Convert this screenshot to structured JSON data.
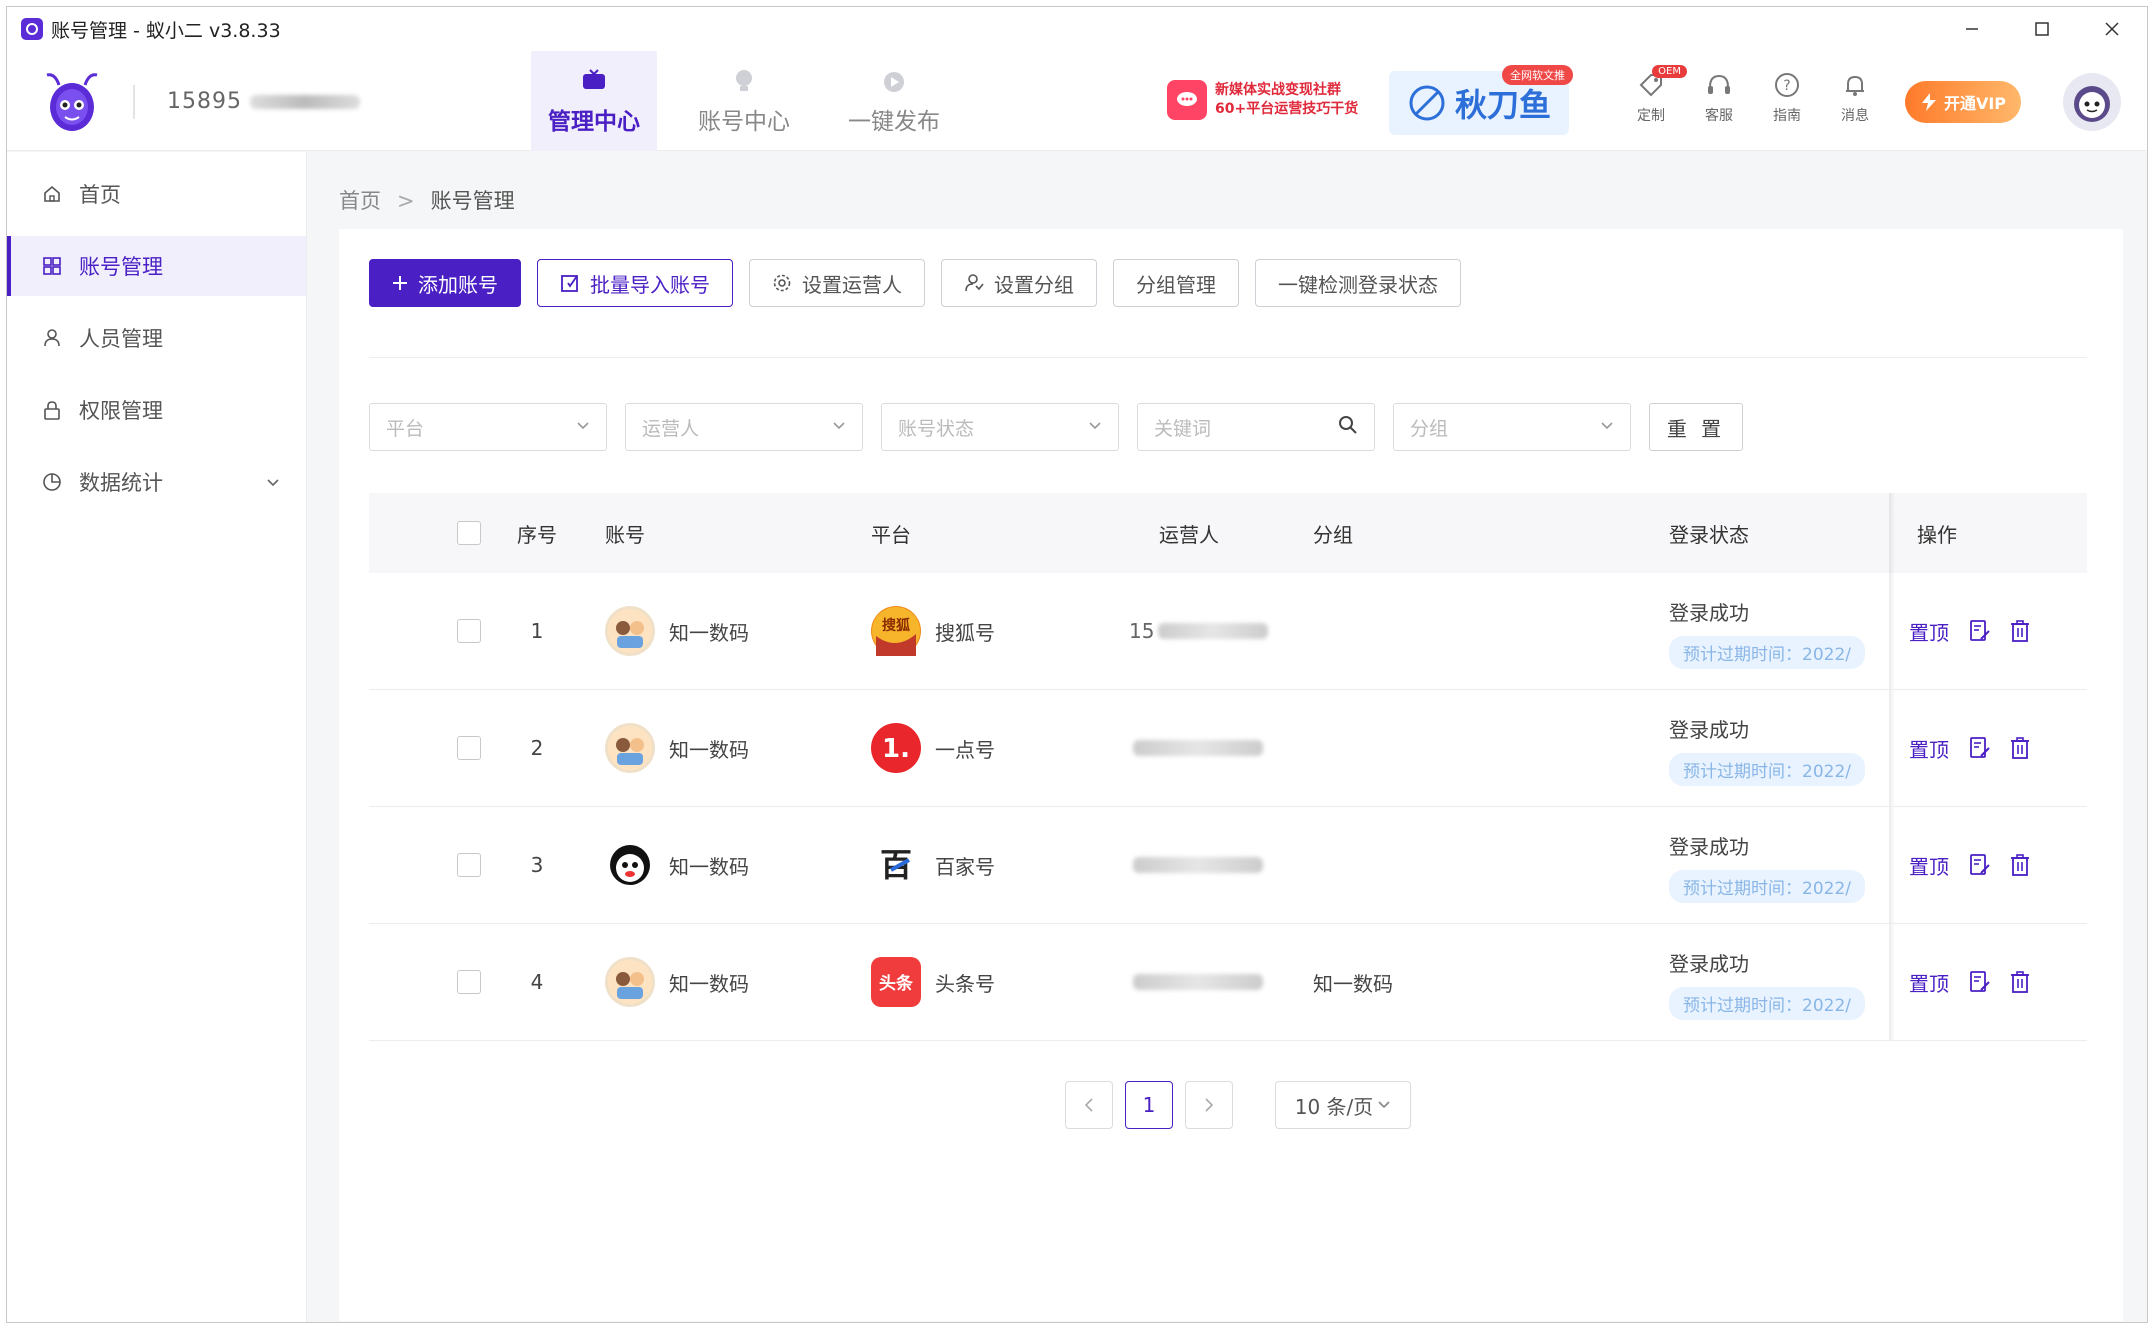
{
  "window": {
    "title": "账号管理 - 蚁小二 v3.8.33"
  },
  "header": {
    "phone_masked": "15895",
    "nav": [
      {
        "label": "管理中心",
        "icon": "tv-icon"
      },
      {
        "label": "账号中心",
        "icon": "bulb-icon"
      },
      {
        "label": "一键发布",
        "icon": "send-icon"
      }
    ],
    "promo1": {
      "line1": "新媒体实战变现社群",
      "line2": "60+平台运营技巧干货"
    },
    "promo2": {
      "brand": "秋刀鱼",
      "tag": "全网软文推"
    },
    "tools": [
      {
        "label": "定制",
        "icon": "tag-icon",
        "badge": "OEM"
      },
      {
        "label": "客服",
        "icon": "headset-icon"
      },
      {
        "label": "指南",
        "icon": "question-icon"
      },
      {
        "label": "消息",
        "icon": "bell-icon"
      }
    ],
    "vip_label": "开通VIP"
  },
  "sidebar": {
    "items": [
      {
        "label": "首页",
        "icon": "home-icon",
        "active": false
      },
      {
        "label": "账号管理",
        "icon": "grid-icon",
        "active": true
      },
      {
        "label": "人员管理",
        "icon": "user-icon",
        "active": false
      },
      {
        "label": "权限管理",
        "icon": "lock-icon",
        "active": false
      },
      {
        "label": "数据统计",
        "icon": "pie-chart-icon",
        "active": false
      }
    ]
  },
  "breadcrumb": {
    "home": "首页",
    "sep": ">",
    "current": "账号管理"
  },
  "toolbar": {
    "add_account": "添加账号",
    "batch_import": "批量导入账号",
    "set_operator": "设置运营人",
    "set_group": "设置分组",
    "group_manage": "分组管理",
    "check_login": "一键检测登录状态"
  },
  "filters": {
    "platform": "平台",
    "operator": "运营人",
    "status": "账号状态",
    "keyword_placeholder": "关键词",
    "group": "分组",
    "reset": "重 置"
  },
  "table": {
    "headers": {
      "no": "序号",
      "account": "账号",
      "platform": "平台",
      "operator": "运营人",
      "group": "分组",
      "status": "登录状态",
      "ops": "操作"
    },
    "rows": [
      {
        "no": "1",
        "account": "知一数码",
        "platform": "搜狐号",
        "platform_color": "#f08a1e",
        "platform_glyph": "搜狐",
        "operator": "15",
        "group": "",
        "status": "登录成功",
        "expire": "预计过期时间：2022/",
        "op_pin": "置顶"
      },
      {
        "no": "2",
        "account": "知一数码",
        "platform": "一点号",
        "platform_color": "#e8262b",
        "platform_glyph": "1.",
        "operator": "",
        "group": "",
        "status": "登录成功",
        "expire": "预计过期时间：2022/",
        "op_pin": "置顶"
      },
      {
        "no": "3",
        "account": "知一数码",
        "platform": "百家号",
        "platform_color": "#ffffff",
        "platform_glyph": "百",
        "operator": "",
        "group": "",
        "status": "登录成功",
        "expire": "预计过期时间：2022/",
        "op_pin": "置顶"
      },
      {
        "no": "4",
        "account": "知一数码",
        "platform": "头条号",
        "platform_color": "#f03c3c",
        "platform_glyph": "头条",
        "operator": "",
        "group": "知一数码",
        "status": "登录成功",
        "expire": "预计过期时间：2022/",
        "op_pin": "置顶"
      }
    ]
  },
  "pagination": {
    "prev": "<",
    "current": "1",
    "next": ">",
    "page_size": "10 条/页"
  },
  "colors": {
    "primary": "#4a1fc4",
    "status_tag_bg": "#e8f3ff",
    "status_tag_text": "#89b6e6"
  }
}
